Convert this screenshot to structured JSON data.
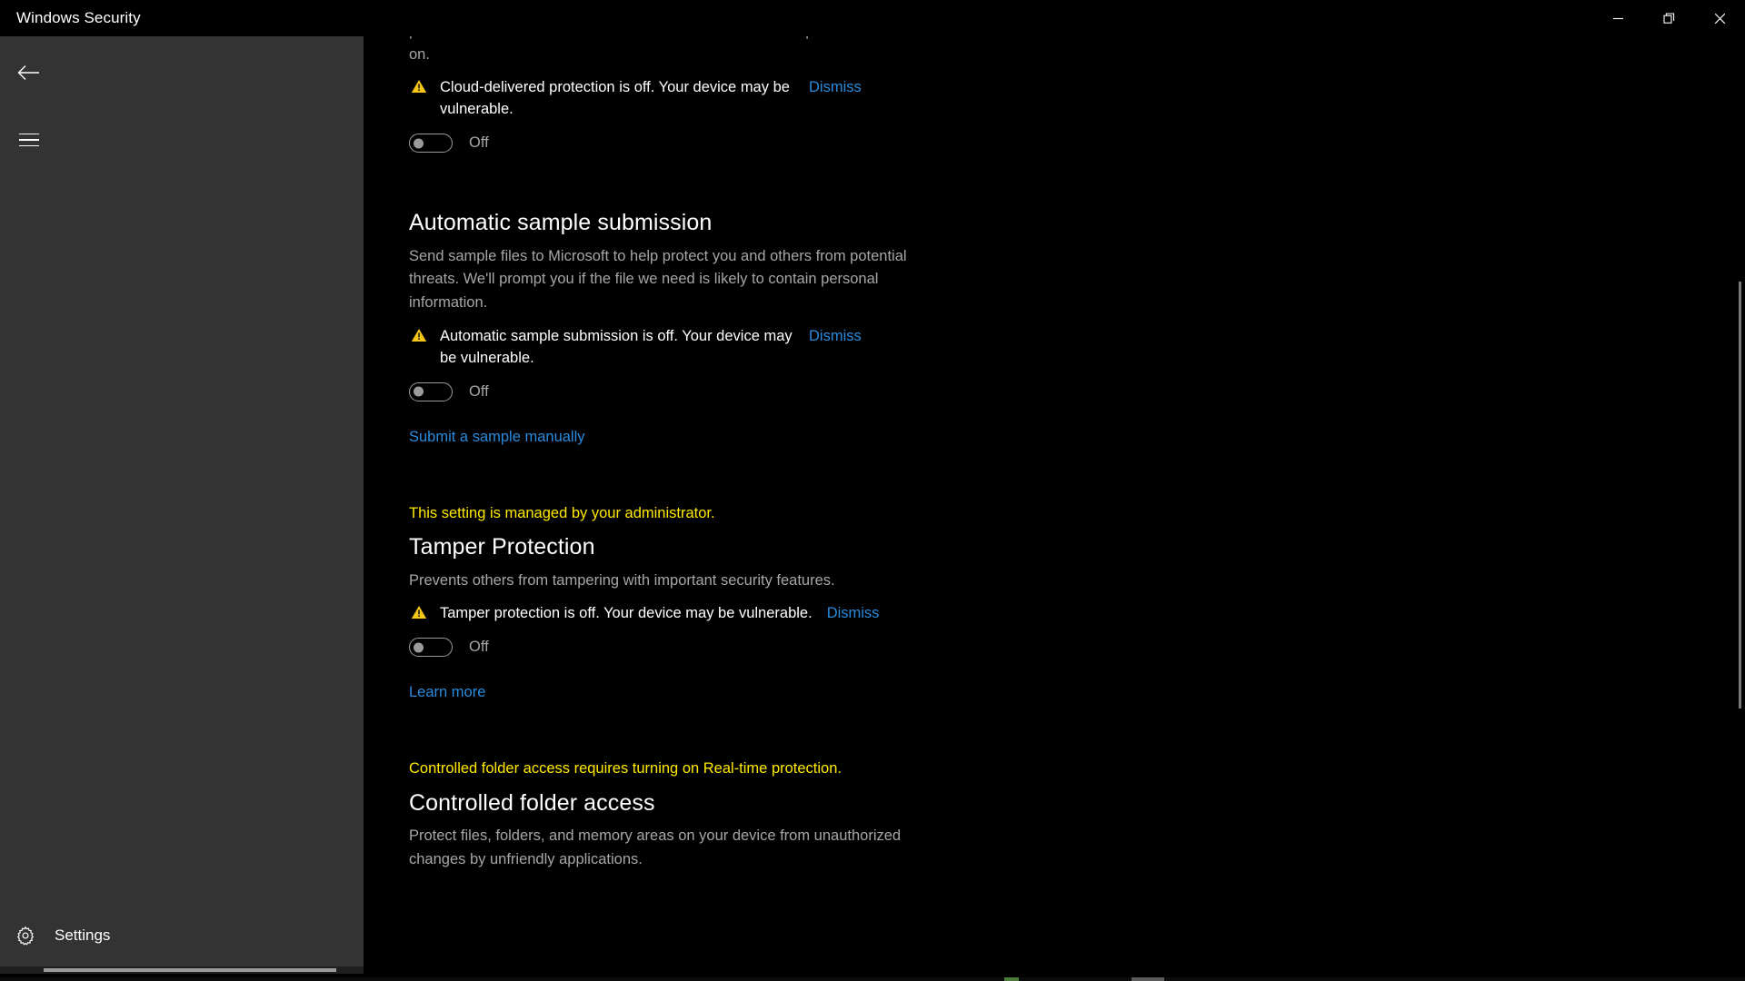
{
  "window": {
    "title": "Windows Security",
    "controls": [
      {
        "name": "minimize",
        "label": "Minimize"
      },
      {
        "name": "restore",
        "label": "Restore"
      },
      {
        "name": "close",
        "label": "Close"
      }
    ]
  },
  "sidebar": {
    "back_label": "Back",
    "menu_label": "Open navigation",
    "settings_label": "Settings"
  },
  "content": {
    "clipped_paragraph": "protection data in the cloud. Works best with Automatic sample submission turned on.",
    "sections": [
      {
        "id": "cloud-delivered-protection",
        "title": null,
        "description": null,
        "warning": {
          "text": "Cloud-delivered protection is off. Your device may be vulnerable.",
          "dismiss_label": "Dismiss"
        },
        "toggle": {
          "state": "Off",
          "checked": false
        }
      },
      {
        "id": "automatic-sample-submission",
        "title": "Automatic sample submission",
        "description": "Send sample files to Microsoft to help protect you and others from potential threats. We'll prompt you if the file we need is likely to contain personal information.",
        "warning": {
          "text": "Automatic sample submission is off. Your device may be vulnerable.",
          "dismiss_label": "Dismiss"
        },
        "toggle": {
          "state": "Off",
          "checked": false
        },
        "link": "Submit a sample manually"
      },
      {
        "id": "tamper-protection",
        "admin_note": "This setting is managed by your administrator.",
        "title": "Tamper Protection",
        "description": "Prevents others from tampering with important security features.",
        "warning": {
          "text": "Tamper protection is off. Your device may be vulnerable.",
          "dismiss_label": "Dismiss"
        },
        "toggle": {
          "state": "Off",
          "checked": false
        },
        "link": "Learn more"
      },
      {
        "id": "controlled-folder-access",
        "admin_note": "Controlled folder access requires turning on Real-time protection.",
        "title": "Controlled folder access",
        "description": "Protect files, folders, and memory areas on your device from unauthorized changes by unfriendly applications."
      }
    ]
  },
  "colors": {
    "accent_link": "#2a8adc",
    "warning_yellow": "#ffe900",
    "warning_icon": "#f5c518",
    "sidebar_bg": "#333333",
    "content_bg": "#000000",
    "titlebar_bg": "#000000",
    "body_text": "#ffffff",
    "muted_text": "#a6a6a6"
  }
}
